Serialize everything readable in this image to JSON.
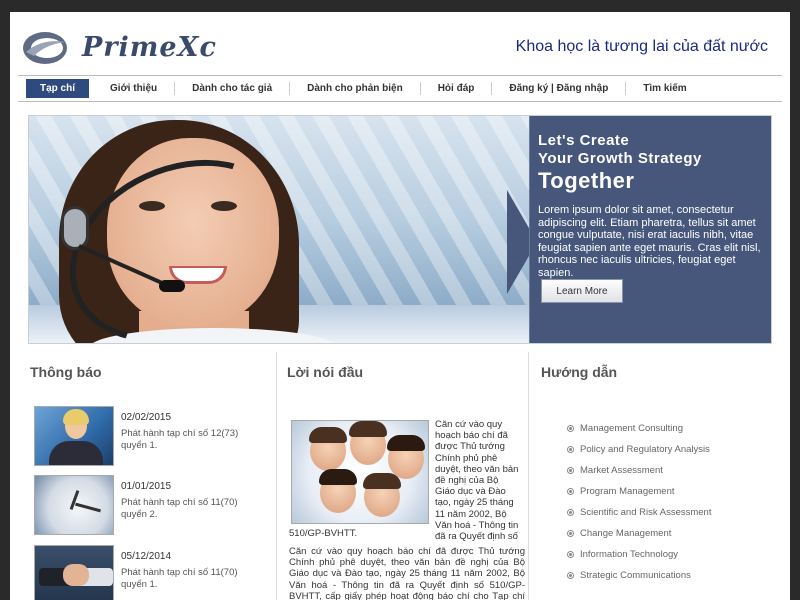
{
  "header": {
    "logo_text": "PrimeXc",
    "slogan": "Khoa học là tương lai của đất nước"
  },
  "nav": {
    "items": [
      {
        "label": "Tạp chí",
        "active": true
      },
      {
        "label": "Giới thiệu"
      },
      {
        "label": "Dành cho tác giả"
      },
      {
        "label": "Dành cho phản biện"
      },
      {
        "label": "Hỏi đáp"
      },
      {
        "label": "Đăng ký | Đăng nhập"
      },
      {
        "label": "Tìm kiếm"
      }
    ]
  },
  "banner": {
    "heading_line1": "Let's Create",
    "heading_line2": "Your Growth Strategy",
    "heading_big": "Together",
    "body": "Lorem ipsum dolor sit amet, consectetur adipiscing elit. Etiam pharetra, tellus sit amet congue vulputate, nisi erat iaculis nibh, vitae feugiat sapien ante eget mauris. Cras elit nisl, rhoncus nec iaculis ultricies, feugiat eget sapien.",
    "button_label": "Learn More"
  },
  "announcements": {
    "title": "Thông báo",
    "items": [
      {
        "date": "02/02/2015",
        "text": "Phát hành tạp chí số 12(73) quyển 1."
      },
      {
        "date": "01/01/2015",
        "text": "Phát hành tạp chí số 11(70) quyển 2."
      },
      {
        "date": "05/12/2014",
        "text": "Phát hành tạp chí số 11(70) quyển 1."
      }
    ]
  },
  "foreword": {
    "title": "Lời nói đầu",
    "side_text": "Căn cứ vào quy hoạch báo chí đã được Thủ tướng Chính phủ phê duyệt, theo văn bản đề nghị của Bộ Giáo dục và Đào tạo, ngày 25 tháng 11 năm 2002, Bộ Văn hoá - Thông tin đã ra Quyết định số",
    "side_text_cont": "510/GP-BVHTT.",
    "body": "Căn cứ vào quy hoạch báo chí đã được Thủ tướng Chính phủ phê duyệt, theo văn bản đề nghị của Bộ Giáo dục và Đào tạo, ngày 25 tháng 11 năm 2002, Bộ Văn hoá - Thông tin đã ra Quyết định số 510/GP-BVHTT, cấp giấy phép hoạt động báo chí cho Tạp chí \"Khoa học và Công nghệ\" Đại học Đà Nẵng."
  },
  "guide": {
    "title": "Hướng dẫn",
    "items": [
      "Management Consulting",
      "Policy and Regulatory Analysis",
      "Market Assessment",
      "Program Management",
      "Scientific and Risk Assessment",
      "Change Management",
      "Information Technology",
      "Strategic Communications"
    ]
  },
  "colors": {
    "brand": "#2e4a7e",
    "panel": "#46577b",
    "slogan": "#1a2a80"
  }
}
